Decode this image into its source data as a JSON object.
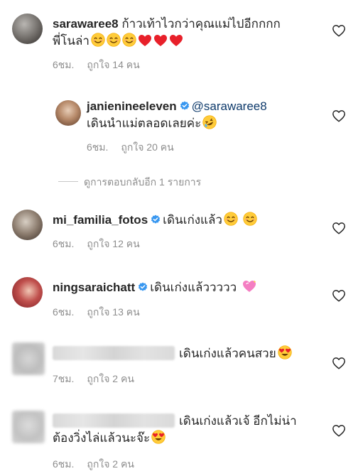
{
  "comments": [
    {
      "username": "sarawaree8",
      "text_line1": "ก้าวเท้าไวกว่าคุณแม่ไปอีกกกก",
      "text_line2": "พี่โนล่า",
      "time": "6ชม.",
      "likes": "ถูกใจ 14 คน"
    },
    {
      "username": "janienineeleven",
      "mention": "@sarawaree8",
      "text_line2": "เดินนำแม่ตลอดเลยค่ะ",
      "time": "6ชม.",
      "likes": "ถูกใจ 20 คน",
      "more_replies": "ดูการตอบกลับอีก 1 รายการ"
    },
    {
      "username": "mi_familia_fotos",
      "text": "เดินเก่งแล้ว",
      "time": "6ชม.",
      "likes": "ถูกใจ 12 คน"
    },
    {
      "username": "ningsaraichatt",
      "text": "เดินเก่งแล้ววววว",
      "time": "6ชม.",
      "likes": "ถูกใจ 13 คน"
    },
    {
      "text": "เดินเก่งแล้วคนสวย",
      "time": "7ชม.",
      "likes": "ถูกใจ 2 คน"
    },
    {
      "text_line1": "เดินเก่งแล้วเจ้ อีกไม่น่า",
      "text_line2": "ต้องวิ่งไล่แล้วนะจ๊ะ",
      "time": "6ชม.",
      "likes": "ถูกใจ 2 คน"
    }
  ],
  "colors": {
    "text": "#262626",
    "meta": "#8e8e8e",
    "verified": "#3897f0",
    "mention": "#0e3a6b",
    "heart_emoji": "#e8202a"
  },
  "icons": [
    "heart-outline-icon",
    "verified-badge-icon",
    "smiling-face-emoji",
    "red-heart-emoji",
    "rofl-emoji",
    "heart-eyes-emoji",
    "sparkling-heart-emoji"
  ]
}
